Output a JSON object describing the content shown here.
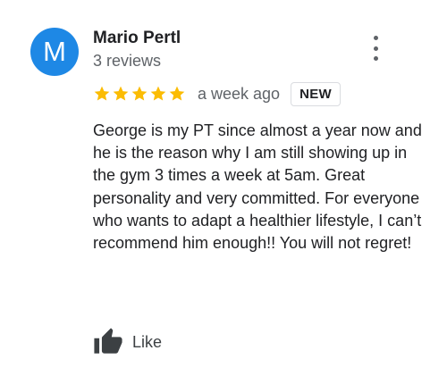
{
  "review": {
    "avatar_initial": "M",
    "reviewer_name": "Mario Pertl",
    "review_count": "3 reviews",
    "rating": 5,
    "rating_max": 5,
    "time_ago": "a week ago",
    "badge": "NEW",
    "text": "George is my PT since almost a year now and he is the reason why I am still showing up in the gym 3 times a week at 5am. Great personality and very committed. For everyone who wants to adapt a healthier lifestyle, I can’t recommend him enough!! You will not regret!",
    "like_label": "Like"
  },
  "icons": {
    "more": "more-vert-icon",
    "star": "star-icon",
    "like": "thumbs-up-icon"
  },
  "colors": {
    "avatar_bg": "#1e88e5",
    "star": "#fbbc04",
    "secondary_text": "#5f6368",
    "primary_text": "#202124",
    "like_icon": "#3c4043"
  }
}
